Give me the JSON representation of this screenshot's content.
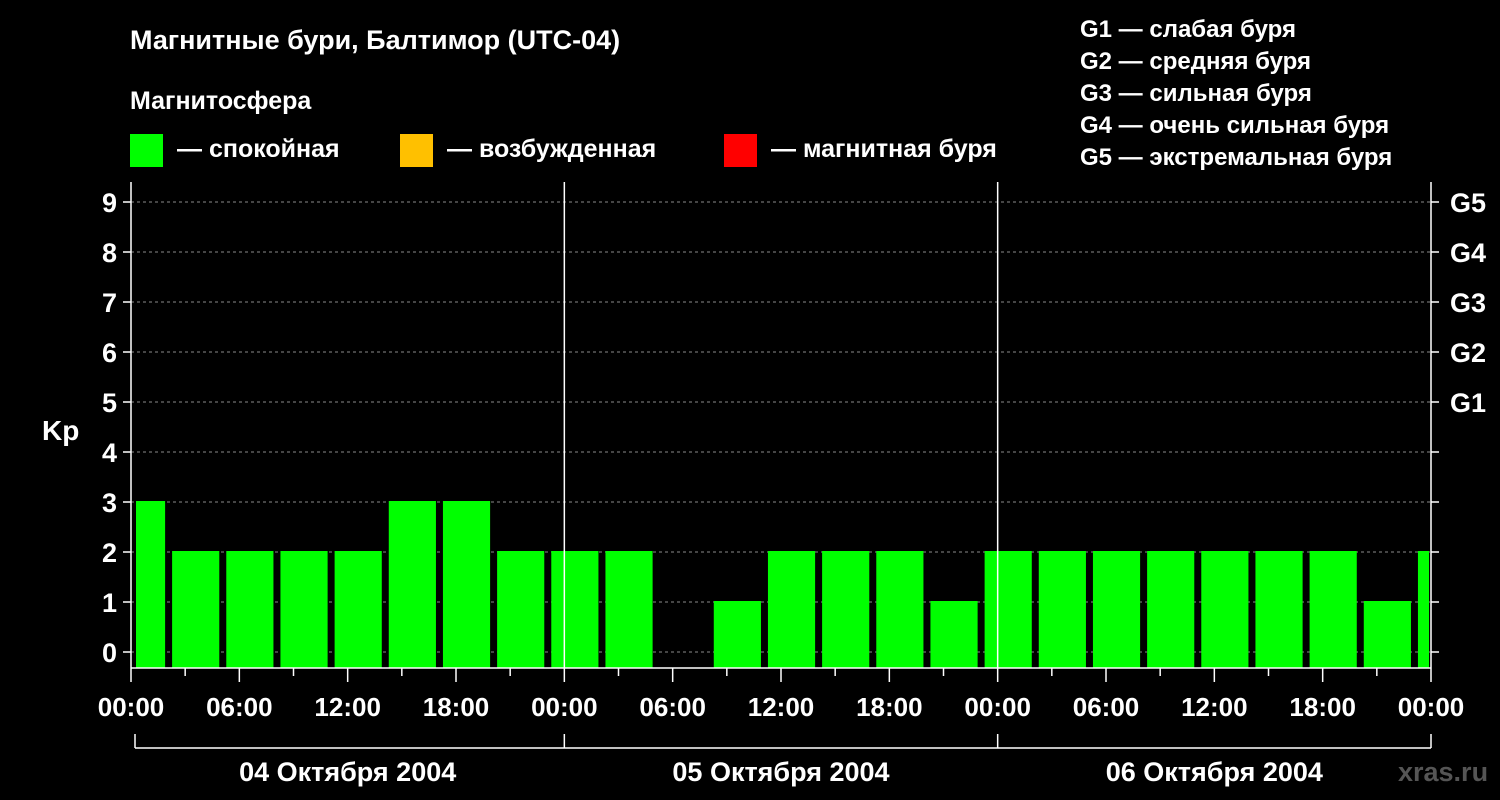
{
  "chart_data": {
    "type": "bar",
    "title": "Магнитные бури, Балтимор (UTC-04)",
    "legend": {
      "heading": "Магнитосфера",
      "items": [
        {
          "label": "— спокойная",
          "color": "#00ff00"
        },
        {
          "label": "— возбужденная",
          "color": "#ffc000"
        },
        {
          "label": "— магнитная буря",
          "color": "#ff0000"
        }
      ]
    },
    "storm_scale": [
      "G1 — слабая буря",
      "G2 — средняя буря",
      "G3 — сильная буря",
      "G4 — очень сильная буря",
      "G5 — экстремальная буря"
    ],
    "ylabel": "Kp",
    "ylim": [
      0,
      9
    ],
    "y_ticks": [
      "0",
      "1",
      "2",
      "3",
      "4",
      "5",
      "6",
      "7",
      "8",
      "9"
    ],
    "g_ticks": [
      {
        "kp": 5,
        "label": "G1"
      },
      {
        "kp": 6,
        "label": "G2"
      },
      {
        "kp": 7,
        "label": "G3"
      },
      {
        "kp": 8,
        "label": "G4"
      },
      {
        "kp": 9,
        "label": "G5"
      }
    ],
    "x_range_hours": [
      0,
      72
    ],
    "x_tick_labels": [
      "00:00",
      "06:00",
      "12:00",
      "18:00",
      "00:00",
      "06:00",
      "12:00",
      "18:00",
      "00:00",
      "06:00",
      "12:00",
      "18:00",
      "00:00"
    ],
    "days": [
      "04 Октября 2004",
      "05 Октября 2004",
      "06 Октября 2004"
    ],
    "bar_color": "#00ff00",
    "bars": [
      {
        "start": 0,
        "end": 2,
        "kp": 3
      },
      {
        "start": 2,
        "end": 5,
        "kp": 2
      },
      {
        "start": 5,
        "end": 8,
        "kp": 2
      },
      {
        "start": 8,
        "end": 11,
        "kp": 2
      },
      {
        "start": 11,
        "end": 14,
        "kp": 2
      },
      {
        "start": 14,
        "end": 17,
        "kp": 3
      },
      {
        "start": 17,
        "end": 20,
        "kp": 3
      },
      {
        "start": 20,
        "end": 23,
        "kp": 2
      },
      {
        "start": 23,
        "end": 26,
        "kp": 2
      },
      {
        "start": 26,
        "end": 29,
        "kp": 2
      },
      {
        "start": 29,
        "end": 32,
        "kp": 0
      },
      {
        "start": 32,
        "end": 35,
        "kp": 1
      },
      {
        "start": 35,
        "end": 38,
        "kp": 2
      },
      {
        "start": 38,
        "end": 41,
        "kp": 2
      },
      {
        "start": 41,
        "end": 44,
        "kp": 2
      },
      {
        "start": 44,
        "end": 47,
        "kp": 1
      },
      {
        "start": 47,
        "end": 50,
        "kp": 2
      },
      {
        "start": 50,
        "end": 53,
        "kp": 2
      },
      {
        "start": 53,
        "end": 56,
        "kp": 2
      },
      {
        "start": 56,
        "end": 59,
        "kp": 2
      },
      {
        "start": 59,
        "end": 62,
        "kp": 2
      },
      {
        "start": 62,
        "end": 65,
        "kp": 2
      },
      {
        "start": 65,
        "end": 68,
        "kp": 2
      },
      {
        "start": 68,
        "end": 71,
        "kp": 1
      },
      {
        "start": 71,
        "end": 72,
        "kp": 2
      }
    ],
    "grid": true,
    "watermark": "xras.ru"
  }
}
